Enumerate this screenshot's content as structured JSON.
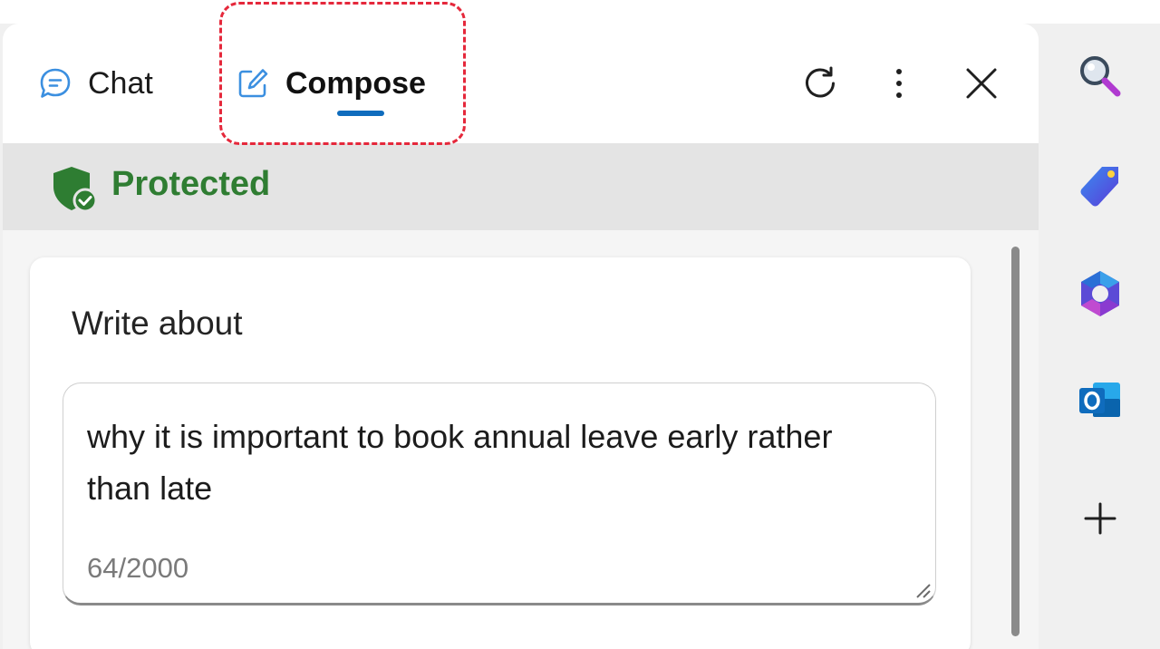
{
  "tabs": {
    "chat_label": "Chat",
    "compose_label": "Compose",
    "active": "Compose"
  },
  "header": {
    "refresh_icon": "refresh-icon",
    "more_icon": "more-options-icon",
    "close_icon": "close-icon"
  },
  "status": {
    "label": "Protected",
    "icon": "shield-check-icon",
    "color": "#2f7d32"
  },
  "compose": {
    "title": "Write about",
    "input_value": "why it is important to book annual leave early rather than late",
    "char_count": "64/2000"
  },
  "sidebar": {
    "items": [
      {
        "icon": "search-icon"
      },
      {
        "icon": "shopping-tag-icon"
      },
      {
        "icon": "microsoft-365-icon"
      },
      {
        "icon": "outlook-icon"
      },
      {
        "icon": "add-icon"
      }
    ]
  },
  "colors": {
    "accent": "#0f6cbd",
    "highlight": "#e5283b"
  }
}
